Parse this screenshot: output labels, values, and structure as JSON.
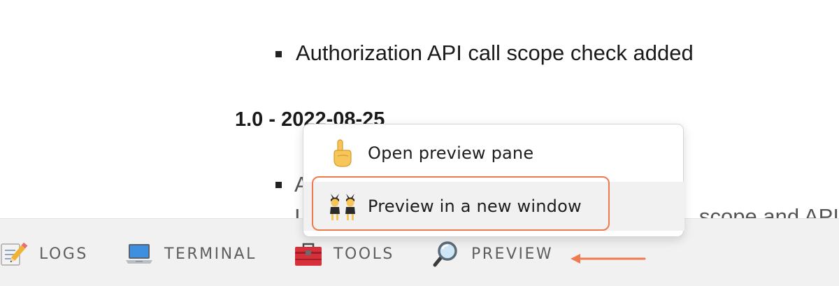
{
  "document": {
    "bullet_item": "Authorization API call scope check added",
    "version_heading": "1.0 - 2022-08-25",
    "partial_bullet_text": "A",
    "partial_line_start": "I",
    "partial_line_end": "scope and API r"
  },
  "toolbar": {
    "items": [
      {
        "label": "LOGS",
        "icon": "memo-pencil-icon"
      },
      {
        "label": "TERMINAL",
        "icon": "laptop-icon"
      },
      {
        "label": "TOOLS",
        "icon": "toolbox-icon"
      },
      {
        "label": "PREVIEW",
        "icon": "magnifier-icon"
      }
    ]
  },
  "context_menu": {
    "items": [
      {
        "label": "Open preview pane",
        "icon": "pointing-up-hand-icon"
      },
      {
        "label": "Preview in a new window",
        "icon": "people-with-bunny-ears-icon"
      }
    ],
    "highlighted_index": 1
  },
  "colors": {
    "accent": "#f07a50",
    "toolbar_bg": "#f1f1f1",
    "toolbar_text": "#5e5e5e",
    "menu_hover_bg": "#f1f1f1"
  }
}
